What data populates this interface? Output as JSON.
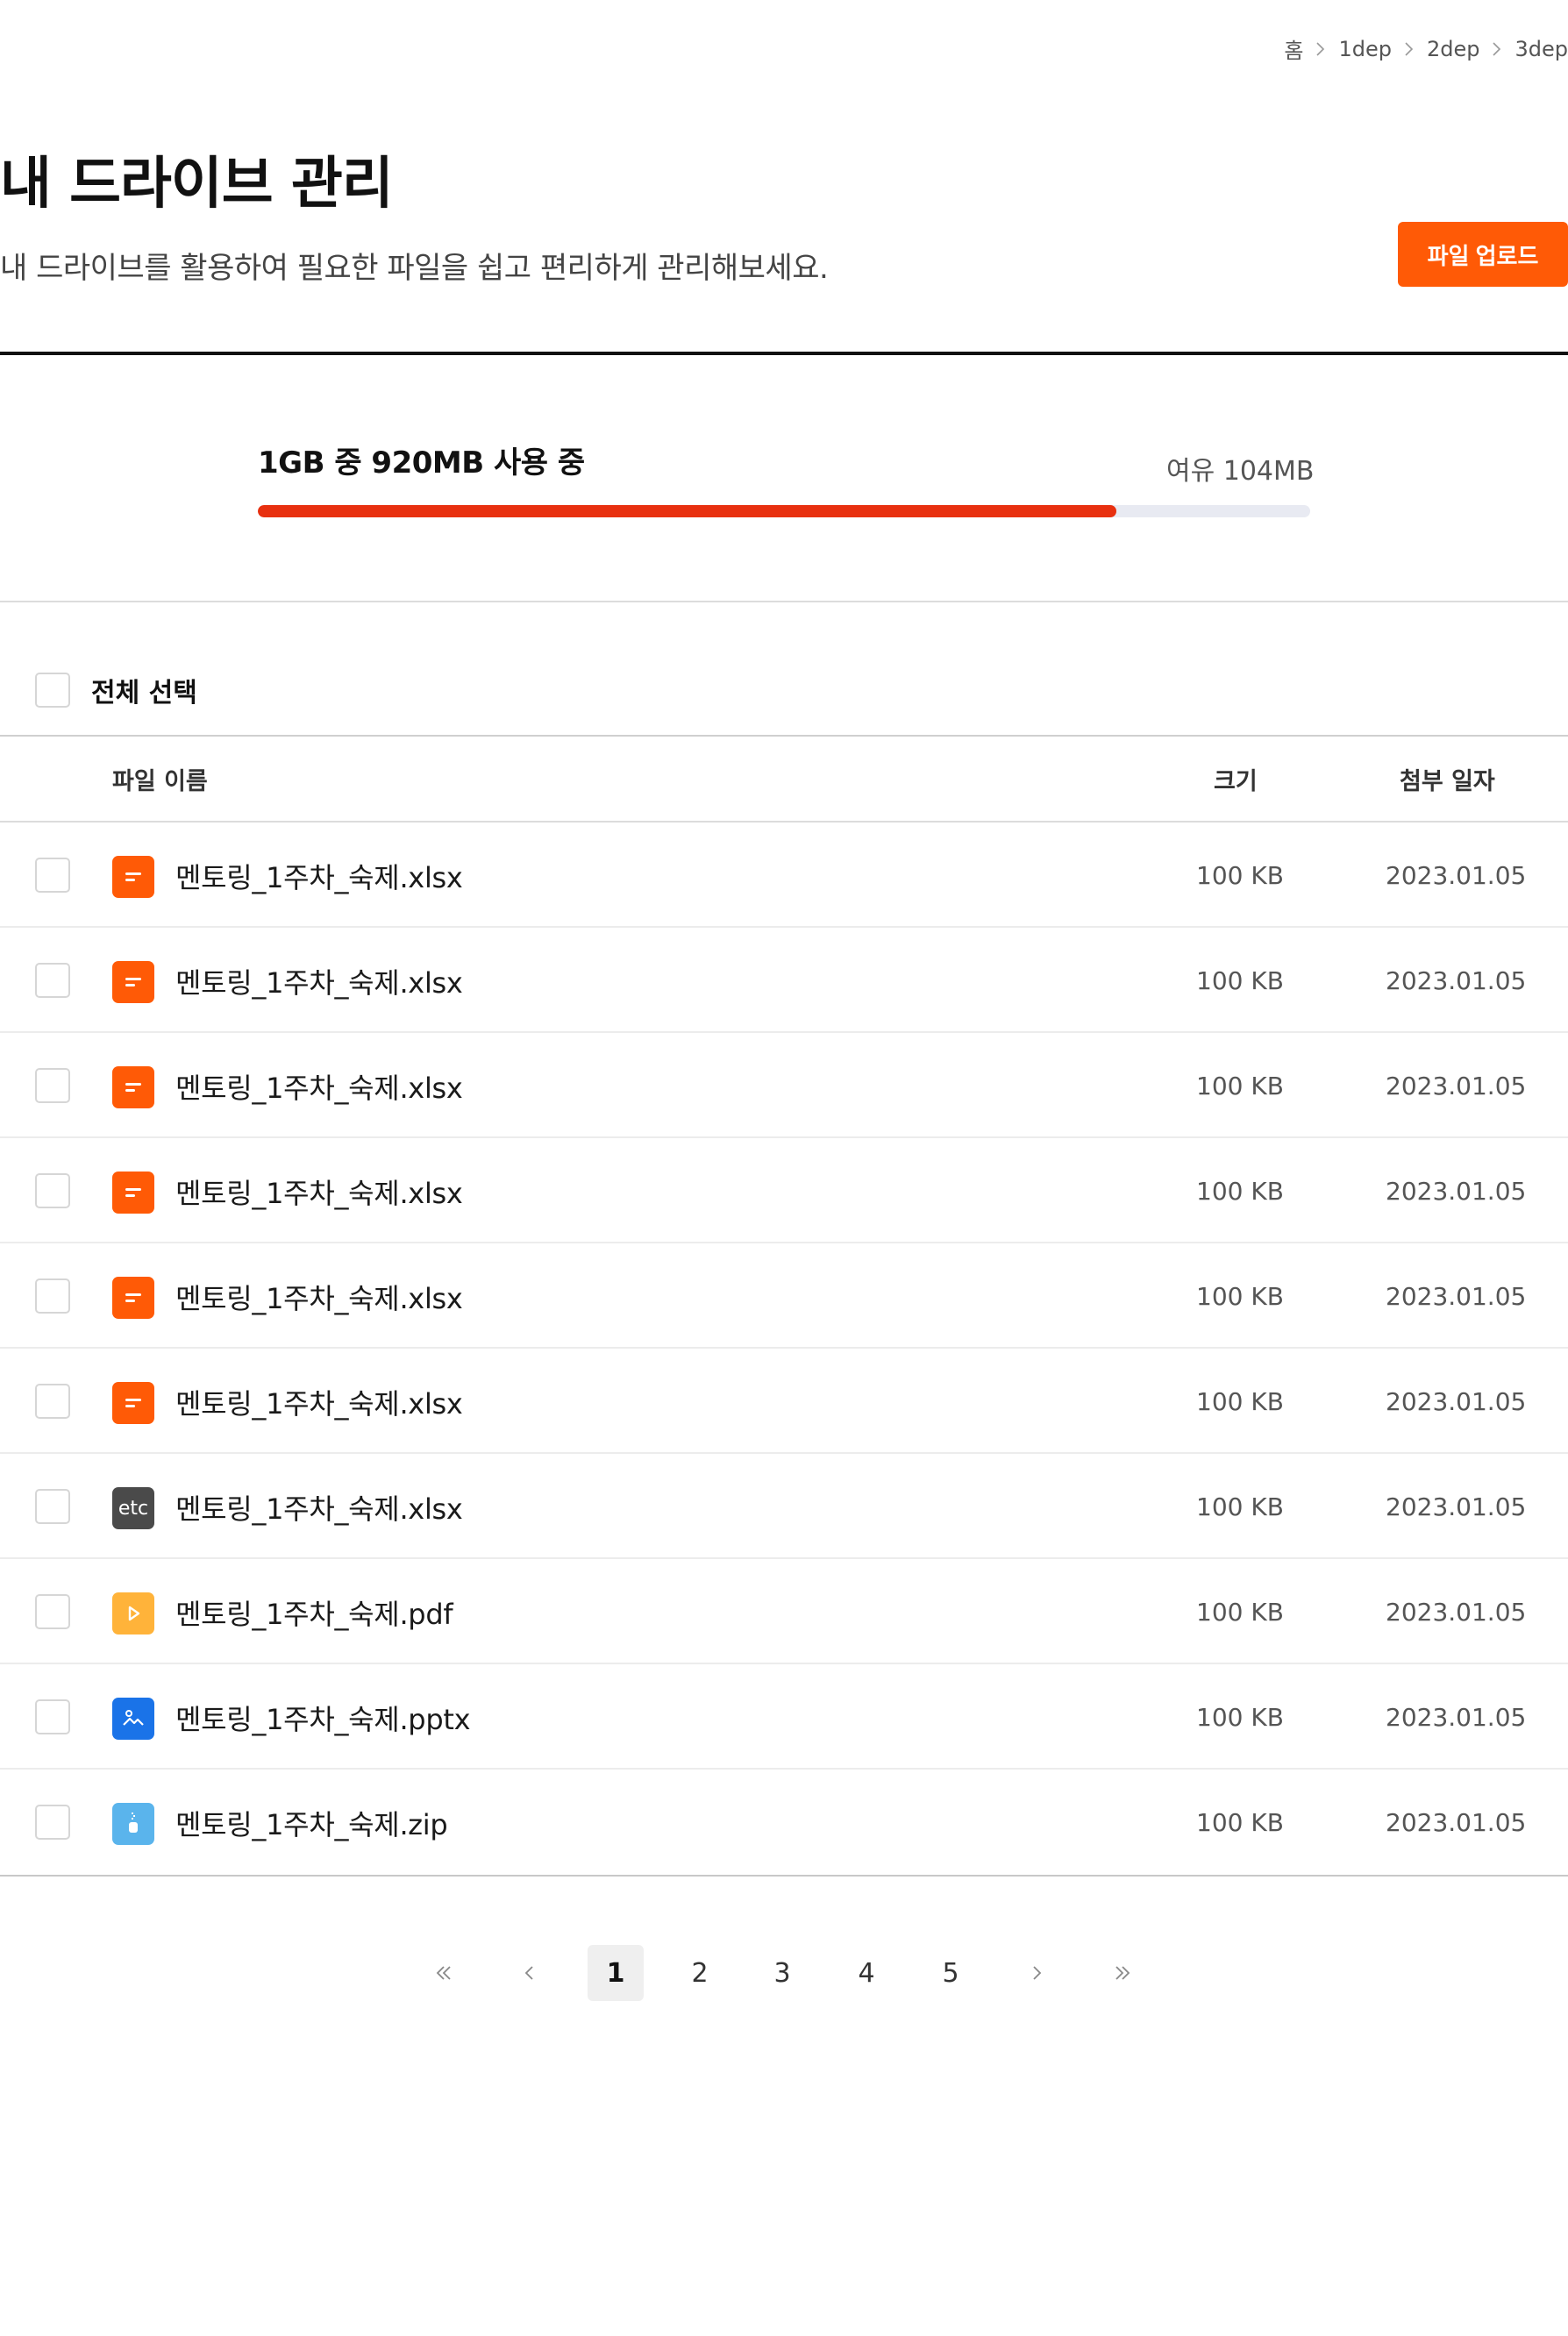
{
  "breadcrumb": [
    "홈",
    "1dep",
    "2dep",
    "3dep"
  ],
  "header": {
    "title": "내 드라이브 관리",
    "description": "내 드라이브를 활용하여 필요한 파일을 쉽고 편리하게 관리해보세요.",
    "upload_label": "파일 업로드"
  },
  "storage": {
    "used_label": "1GB 중 920MB 사용 중",
    "free_label": "여유 104MB",
    "used_fraction": 0.816,
    "fill_color": "#e8300f",
    "track_color": "#e8eaf2"
  },
  "select_all_label": "전체 선택",
  "table": {
    "columns": {
      "name": "파일 이름",
      "size": "크기",
      "date": "첨부 일자"
    },
    "rows": [
      {
        "icon": "document-icon",
        "icon_color": "#ff5a06",
        "name": "멘토링_1주차_숙제.xlsx",
        "size": "100 KB",
        "date": "2023.01.05"
      },
      {
        "icon": "document-icon",
        "icon_color": "#ff5a06",
        "name": "멘토링_1주차_숙제.xlsx",
        "size": "100 KB",
        "date": "2023.01.05"
      },
      {
        "icon": "document-icon",
        "icon_color": "#ff5a06",
        "name": "멘토링_1주차_숙제.xlsx",
        "size": "100 KB",
        "date": "2023.01.05"
      },
      {
        "icon": "document-icon",
        "icon_color": "#ff5a06",
        "name": "멘토링_1주차_숙제.xlsx",
        "size": "100 KB",
        "date": "2023.01.05"
      },
      {
        "icon": "document-icon",
        "icon_color": "#ff5a06",
        "name": "멘토링_1주차_숙제.xlsx",
        "size": "100 KB",
        "date": "2023.01.05"
      },
      {
        "icon": "document-icon",
        "icon_color": "#ff5a06",
        "name": "멘토링_1주차_숙제.xlsx",
        "size": "100 KB",
        "date": "2023.01.05"
      },
      {
        "icon": "etc-file-icon",
        "icon_color": "#4a4a4a",
        "icon_text": "etc",
        "name": "멘토링_1주차_숙제.xlsx",
        "size": "100 KB",
        "date": "2023.01.05"
      },
      {
        "icon": "play-icon",
        "icon_color": "#ffb33a",
        "name": "멘토링_1주차_숙제.pdf",
        "size": "100 KB",
        "date": "2023.01.05"
      },
      {
        "icon": "image-icon",
        "icon_color": "#1a73e8",
        "name": "멘토링_1주차_숙제.pptx",
        "size": "100 KB",
        "date": "2023.01.05"
      },
      {
        "icon": "zip-icon",
        "icon_color": "#5ab4ec",
        "name": "멘토링_1주차_숙제.zip",
        "size": "100 KB",
        "date": "2023.01.05"
      }
    ]
  },
  "pagination": {
    "pages": [
      "1",
      "2",
      "3",
      "4",
      "5"
    ],
    "current": "1"
  }
}
